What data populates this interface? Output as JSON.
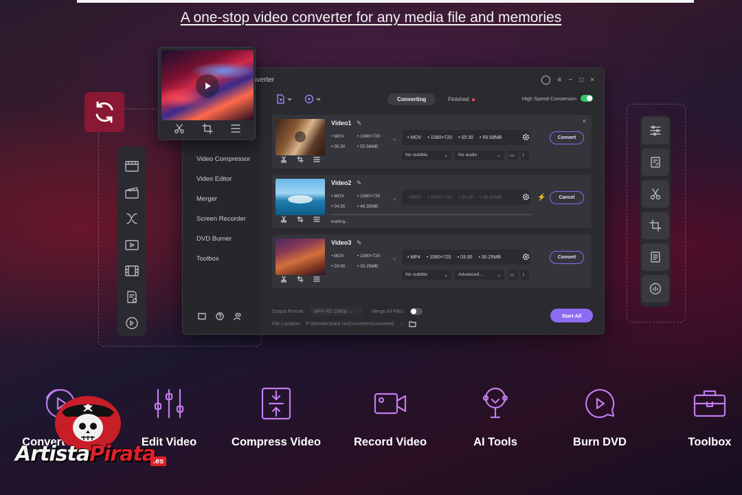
{
  "header": {
    "tagline": "A one-stop video converter for any media file and memories"
  },
  "app": {
    "title": "nverter",
    "window_controls": {
      "menu": "≡",
      "minimize": "−",
      "maximize": "□",
      "close": "×"
    },
    "sidebar": {
      "items": [
        "Video Compressor",
        "Video Editor",
        "Merger",
        "Screen Recorder",
        "DVD Burner",
        "Toolbox"
      ]
    },
    "tabs": {
      "converting": "Converting",
      "finished": "Finished"
    },
    "high_speed_label": "High Speed Conversion",
    "files": [
      {
        "name": "Video1",
        "src_format": "MOV",
        "src_res": "1080×720",
        "src_duration": "05:30",
        "src_size": "55.58MB",
        "out_format": "MOV",
        "out_res": "1080×720",
        "out_duration": "05:30",
        "out_size": "55.58MB",
        "subtitle": "No subtitle",
        "audio": "No audio",
        "action": "Convert"
      },
      {
        "name": "Video2",
        "src_format": "MOV",
        "src_res": "1080×720",
        "src_duration": "04:35",
        "src_size": "46.35MB",
        "out_format": "MOV",
        "out_res": "1080×720",
        "out_duration": "04:35",
        "out_size": "46.35MB",
        "status": "waiting...",
        "action": "Cancel"
      },
      {
        "name": "Video3",
        "src_format": "MOV",
        "src_res": "1080×720",
        "src_duration": "03:30",
        "src_size": "30.25MB",
        "out_format": "MP4",
        "out_res": "1080×720",
        "out_duration": "03:30",
        "out_size": "30.25MB",
        "subtitle": "No subtitle",
        "audio": "Advanced...",
        "action": "Convert"
      }
    ],
    "bottom": {
      "output_format_label": "Output Format:",
      "output_format_value": "MP4 HD 1080p",
      "merge_label": "Merge All Files:",
      "file_location_label": "File Location:",
      "file_location_value": "F:\\Wondershare UniConverter\\Converted",
      "start_all": "Start All"
    }
  },
  "features": [
    {
      "label": "Convert Video",
      "icon": "convert-icon"
    },
    {
      "label": "Edit Video",
      "icon": "sliders-icon"
    },
    {
      "label": "Compress Video",
      "icon": "compress-icon"
    },
    {
      "label": "Record Video",
      "icon": "camera-icon"
    },
    {
      "label": "AI Tools",
      "icon": "ai-icon"
    },
    {
      "label": "Burn DVD",
      "icon": "disc-icon"
    },
    {
      "label": "Toolbox",
      "icon": "toolbox-icon"
    }
  ],
  "watermark": {
    "text_white": "Artista",
    "text_red": "Pirata",
    "suffix": ".es"
  },
  "colors": {
    "accent": "#8d6cf3",
    "brand_red": "#8a1733",
    "feature_icon": "#c37cf0",
    "toggle_on": "#35c46a"
  }
}
